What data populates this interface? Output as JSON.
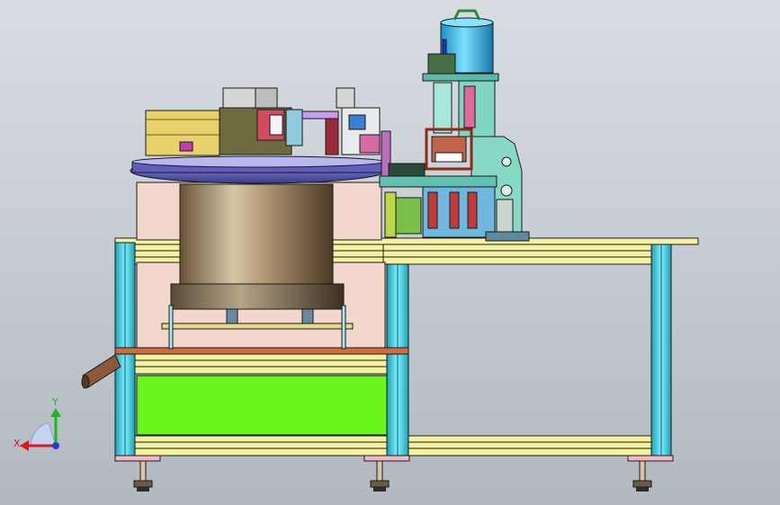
{
  "viewport": {
    "background_top": "#d9dde3",
    "background_bottom": "#b1b8c0"
  },
  "triad": {
    "x_label": "X",
    "y_label": "Y",
    "x_color": "#e0151b",
    "y_color": "#1eb81e",
    "z_color": "#1f3fd6"
  },
  "model": {
    "description_icon": "cad-assembly-icon",
    "colors": {
      "frame_outline": "#1a1a1a",
      "frame_top": "#f4f1a0",
      "frame_post": "#3dd6e6",
      "green_panel": "#6cf51c",
      "bowl_shell": "#8c6f4e",
      "bowl_plate": "#6e6cc7",
      "pink_panel": "#f3d6cc",
      "cylinder": "#2bb9ee",
      "teal_body": "#88d8c6",
      "feet": "#f1b8c8",
      "orange_band": "#d16c3f"
    }
  }
}
